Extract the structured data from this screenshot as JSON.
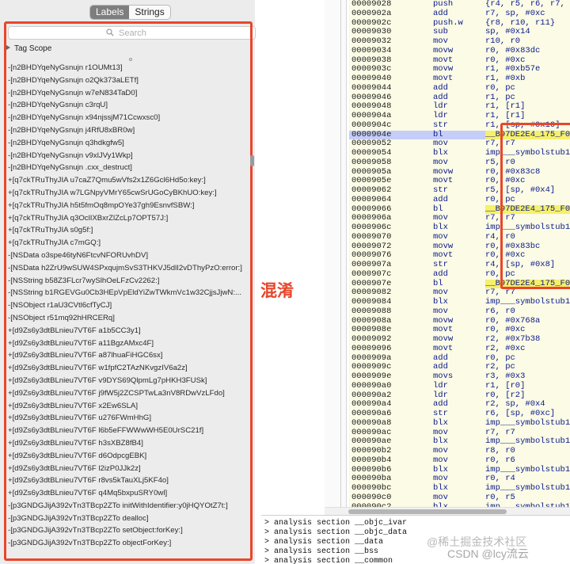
{
  "tabs": [
    {
      "label": "Labels",
      "active": true
    },
    {
      "label": "Strings",
      "active": false
    }
  ],
  "search": {
    "placeholder": "Search"
  },
  "tag_scope": "Tag Scope",
  "labels": [
    "-[n2BHDYqeNyGsnujn r1OUMt13]",
    "-[n2BHDYqeNyGsnujn o2Qk373aLETf]",
    "-[n2BHDYqeNyGsnujn w7eN834TaD0]",
    "-[n2BHDYqeNyGsnujn c3rqU]",
    "-[n2BHDYqeNyGsnujn x94njssjM71Ccwxsc0]",
    "-[n2BHDYqeNyGsnujn j4RfU8xBR0w]",
    "-[n2BHDYqeNyGsnujn q3hdkgfw5]",
    "-[n2BHDYqeNyGsnujn v9xlJVy1Wkp]",
    "-[n2BHDYqeNyGsnujn .cxx_destruct]",
    "+[q7ckTRuThyJIA u7caZ7Qmu5wVfs2x1Z6Gcl6Hd5o:key:]",
    "+[q7ckTRuThyJIA w7LGNpyVMrY65cwSrUGoCyBKhUO:key:]",
    "+[q7ckTRuThyJIA h5t5fmOq8mpOYe37gh9EsnvfSBW:]",
    "+[q7ckTRuThyJIA q3OclIXBxrZlZcLp7OPT57J:]",
    "+[q7ckTRuThyJIA s0g5f:]",
    "+[q7ckTRuThyJIA c7mGQ:]",
    "-[NSData o3spe46tyN6FtcvNFORUvhDV]",
    "-[NSData h2ZrU9wSUW4SPxqujmSvS3THKVJ5dlI2vDThyPzO:error:]",
    "-[NSString b58Z3FLcr7wySlhOeLFzCv2262:]",
    "-[NSString b1RGEVGu0Cb3HEpVpEldYiZwTWkmVc1w32CjjsJjwN:...",
    "-[NSObject r1aU3CVtl6cfTyCJ]",
    "-[NSObject r51mq92hHRCERq]",
    "+[d9Zs6y3dtBLnieu7VT6F a1b5CC3y1]",
    "+[d9Zs6y3dtBLnieu7VT6F a11BgzAMxc4F]",
    "+[d9Zs6y3dtBLnieu7VT6F a87lhuaFiHGC6sx]",
    "+[d9Zs6y3dtBLnieu7VT6F w1fpfC2TAzNKvgzIV6a2z]",
    "+[d9Zs6y3dtBLnieu7VT6F v9DYS69QlpmLg7pHKH3FUSk]",
    "+[d9Zs6y3dtBLnieu7VT6F j9fW5j2ZCSPTwLa3nV8RDwVzLFdo]",
    "+[d9Zs6y3dtBLnieu7VT6F x2Ew6SLA]",
    "+[d9Zs6y3dtBLnieu7VT6F u276FWmHhG]",
    "+[d9Zs6y3dtBLnieu7VT6F l6b5eFFWWwWH5E0UrSC21f]",
    "+[d9Zs6y3dtBLnieu7VT6F h3sXBZ8fB4]",
    "+[d9Zs6y3dtBLnieu7VT6F d6OdpcgEBK]",
    "+[d9Zs6y3dtBLnieu7VT6F l2izP0JJk2z]",
    "+[d9Zs6y3dtBLnieu7VT6F r8vs5kTauXLj5KF4o]",
    "+[d9Zs6y3dtBLnieu7VT6F q4Mq5bxpuSRY0wl]",
    "-[p3GNDGJijA392vTn3TBcp2ZTo initWithIdentifier:y0jHQYOtZ7t:]",
    "-[p3GNDGJijA392vTn3TBcp2ZTo dealloc]",
    "-[p3GNDGJijA392vTn3TBcp2ZTo setObject:forKey:]",
    "-[p3GNDGJijA392vTn3TBcp2ZTo objectForKey:]"
  ],
  "annotation": "混淆",
  "accent_color": "#e8462b",
  "disasm": [
    {
      "addr": "00009028",
      "mn": "push",
      "op": "{r4, r5, r6, r7, lr}"
    },
    {
      "addr": "0000902a",
      "mn": "add",
      "op": "r7, sp, #0xc"
    },
    {
      "addr": "0000902c",
      "mn": "push.w",
      "op": "{r8, r10, r11}"
    },
    {
      "addr": "00009030",
      "mn": "sub",
      "op": "sp, #0x14"
    },
    {
      "addr": "00009032",
      "mn": "mov",
      "op": "r10, r0"
    },
    {
      "addr": "00009034",
      "mn": "movw",
      "op": "r0, #0x83dc"
    },
    {
      "addr": "00009038",
      "mn": "movt",
      "op": "r0, #0xc"
    },
    {
      "addr": "0000903c",
      "mn": "movw",
      "op": "r1, #0xb57e"
    },
    {
      "addr": "00009040",
      "mn": "movt",
      "op": "r1, #0xb"
    },
    {
      "addr": "00009044",
      "mn": "add",
      "op": "r0, pc"
    },
    {
      "addr": "00009046",
      "mn": "add",
      "op": "r1, pc"
    },
    {
      "addr": "00009048",
      "mn": "ldr",
      "op": "r1, [r1]"
    },
    {
      "addr": "0000904a",
      "mn": "ldr",
      "op": "r1, [r1]"
    },
    {
      "addr": "0000904c",
      "mn": "str",
      "op": "r1, [sp, #0x10]"
    },
    {
      "addr": "0000904e",
      "mn": "bl",
      "op": "__B97DE2E4_175_F0C",
      "sel": true,
      "hl": true
    },
    {
      "addr": "00009052",
      "mn": "mov",
      "op": "r7, r7"
    },
    {
      "addr": "00009054",
      "mn": "blx",
      "op": "imp___symbolstub1_"
    },
    {
      "addr": "00009058",
      "mn": "mov",
      "op": "r5, r0"
    },
    {
      "addr": "0000905a",
      "mn": "movw",
      "op": "r0, #0x83c8"
    },
    {
      "addr": "0000905e",
      "mn": "movt",
      "op": "r0, #0xc"
    },
    {
      "addr": "00009062",
      "mn": "str",
      "op": "r5, [sp, #0x4]"
    },
    {
      "addr": "00009064",
      "mn": "add",
      "op": "r0, pc"
    },
    {
      "addr": "00009066",
      "mn": "bl",
      "op": "__B97DE2E4_175_F0C",
      "hl": true
    },
    {
      "addr": "0000906a",
      "mn": "mov",
      "op": "r7, r7"
    },
    {
      "addr": "0000906c",
      "mn": "blx",
      "op": "imp___symbolstub1_"
    },
    {
      "addr": "00009070",
      "mn": "mov",
      "op": "r4, r0"
    },
    {
      "addr": "00009072",
      "mn": "movw",
      "op": "r0, #0x83bc"
    },
    {
      "addr": "00009076",
      "mn": "movt",
      "op": "r0, #0xc"
    },
    {
      "addr": "0000907a",
      "mn": "str",
      "op": "r4, [sp, #0x8]"
    },
    {
      "addr": "0000907c",
      "mn": "add",
      "op": "r0, pc"
    },
    {
      "addr": "0000907e",
      "mn": "bl",
      "op": "__B97DE2E4_175_F0C",
      "hl": true
    },
    {
      "addr": "00009082",
      "mn": "mov",
      "op": "r7, r7"
    },
    {
      "addr": "00009084",
      "mn": "blx",
      "op": "imp___symbolstub1_"
    },
    {
      "addr": "00009088",
      "mn": "mov",
      "op": "r6, r0"
    },
    {
      "addr": "0000908a",
      "mn": "movw",
      "op": "r0, #0x768a"
    },
    {
      "addr": "0000908e",
      "mn": "movt",
      "op": "r0, #0xc"
    },
    {
      "addr": "00009092",
      "mn": "movw",
      "op": "r2, #0x7b38"
    },
    {
      "addr": "00009096",
      "mn": "movt",
      "op": "r2, #0xc"
    },
    {
      "addr": "0000909a",
      "mn": "add",
      "op": "r0, pc"
    },
    {
      "addr": "0000909c",
      "mn": "add",
      "op": "r2, pc"
    },
    {
      "addr": "0000909e",
      "mn": "movs",
      "op": "r3, #0x3"
    },
    {
      "addr": "000090a0",
      "mn": "ldr",
      "op": "r1, [r0]"
    },
    {
      "addr": "000090a2",
      "mn": "ldr",
      "op": "r0, [r2]"
    },
    {
      "addr": "000090a4",
      "mn": "add",
      "op": "r2, sp, #0x4"
    },
    {
      "addr": "000090a6",
      "mn": "str",
      "op": "r6, [sp, #0xc]"
    },
    {
      "addr": "000090a8",
      "mn": "blx",
      "op": "imp___symbolstub1_"
    },
    {
      "addr": "000090ac",
      "mn": "mov",
      "op": "r7, r7"
    },
    {
      "addr": "000090ae",
      "mn": "blx",
      "op": "imp___symbolstub1_"
    },
    {
      "addr": "000090b2",
      "mn": "mov",
      "op": "r8, r0"
    },
    {
      "addr": "000090b4",
      "mn": "mov",
      "op": "r0, r6"
    },
    {
      "addr": "000090b6",
      "mn": "blx",
      "op": "imp___symbolstub1_"
    },
    {
      "addr": "000090ba",
      "mn": "mov",
      "op": "r0, r4"
    },
    {
      "addr": "000090bc",
      "mn": "blx",
      "op": "imp___symbolstub1_"
    },
    {
      "addr": "000090c0",
      "mn": "mov",
      "op": "r0, r5"
    },
    {
      "addr": "000090c2",
      "mn": "blx",
      "op": "imp___symbolstub1_"
    }
  ],
  "output_log": [
    "> analysis section __objc_ivar",
    "> analysis section __objc_data",
    "> analysis section __data",
    "> analysis section __bss",
    "> analysis section __common"
  ],
  "watermark": "@稀土掘金技术社区",
  "watermark2": "CSDN @lcy流云"
}
